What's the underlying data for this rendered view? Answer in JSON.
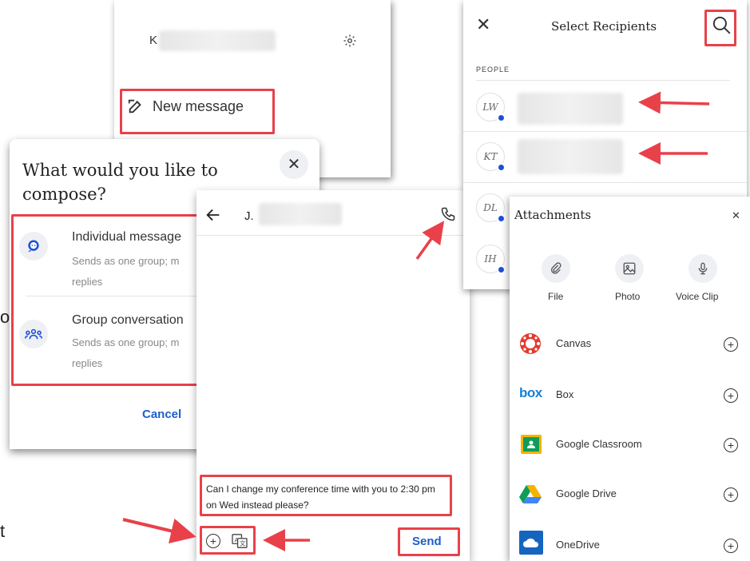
{
  "menu_panel": {
    "user_initial": "K",
    "new_message_label": "New message"
  },
  "compose_dialog": {
    "title": "What would you like to compose?",
    "options": [
      {
        "title": "Individual message",
        "desc": "Sends as one group; m replies"
      },
      {
        "title": "Group conversation",
        "desc": "Sends as one group; m replies"
      }
    ],
    "cancel_label": "Cancel"
  },
  "chat": {
    "contact_name": "J.",
    "message_text": "Can I change my conference time with you to 2:30 pm on Wed instead please?",
    "send_label": "Send"
  },
  "recipients": {
    "title": "Select Recipients",
    "section_label": "PEOPLE",
    "people": [
      {
        "initials": "LW"
      },
      {
        "initials": "KT"
      },
      {
        "initials": "DL"
      },
      {
        "initials": "IH"
      }
    ]
  },
  "attachments": {
    "title": "Attachments",
    "quick": [
      {
        "label": "File",
        "icon": "paperclip-icon"
      },
      {
        "label": "Photo",
        "icon": "photo-icon"
      },
      {
        "label": "Voice Clip",
        "icon": "microphone-icon"
      }
    ],
    "services": [
      {
        "label": "Canvas",
        "icon": "canvas-logo-icon"
      },
      {
        "label": "Box",
        "icon": "box-logo-icon"
      },
      {
        "label": "Google Classroom",
        "icon": "google-classroom-icon"
      },
      {
        "label": "Google Drive",
        "icon": "google-drive-icon"
      },
      {
        "label": "OneDrive",
        "icon": "onedrive-icon"
      }
    ]
  },
  "cropped_fragments": {
    "left_char_1": "o",
    "left_char_2": "t"
  },
  "colors": {
    "highlight_red": "#e8414a",
    "link_blue": "#1d5fc8",
    "badge_blue": "#1d4fd8"
  }
}
